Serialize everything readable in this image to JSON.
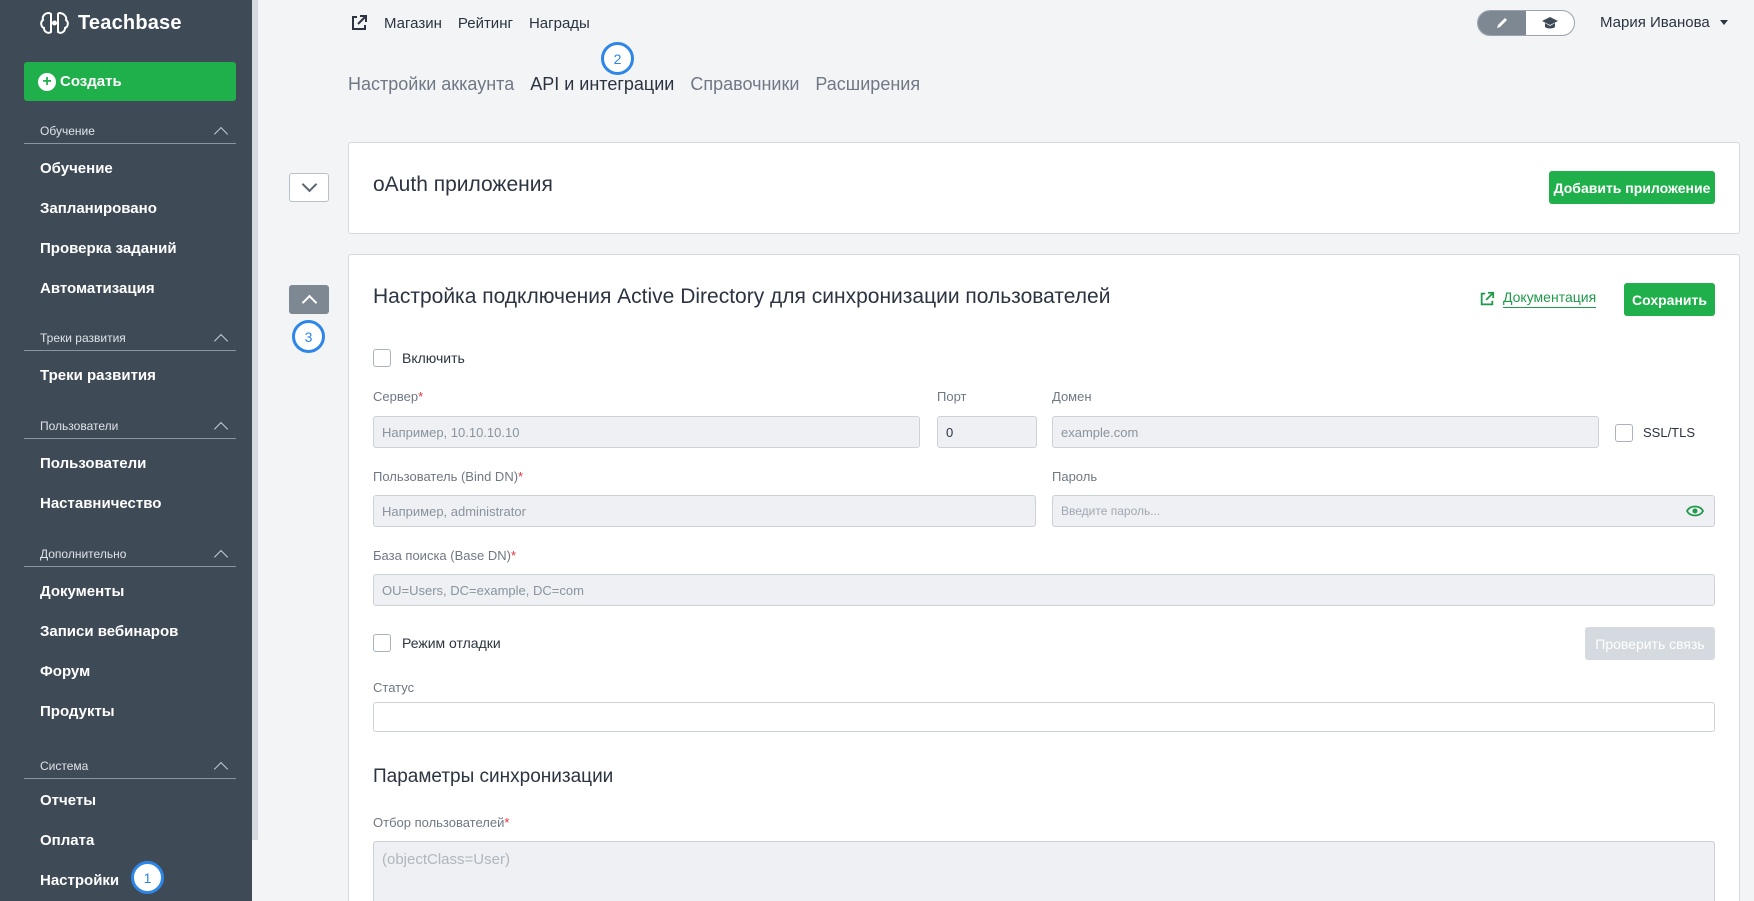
{
  "sidebar": {
    "logo": "Teachbase",
    "create_label": "Создать",
    "sections": [
      {
        "title": "Обучение",
        "items": [
          "Обучение",
          "Запланировано",
          "Проверка заданий",
          "Автоматизация"
        ]
      },
      {
        "title": "Треки развития",
        "items": [
          "Треки развития"
        ]
      },
      {
        "title": "Пользователи",
        "items": [
          "Пользователи",
          "Наставничество"
        ]
      },
      {
        "title": "Дополнительно",
        "items": [
          "Документы",
          "Записи вебинаров",
          "Форум",
          "Продукты"
        ]
      },
      {
        "title": "Система",
        "items": [
          "Отчеты",
          "Оплата",
          "Настройки"
        ]
      }
    ]
  },
  "badges": {
    "b1": "1",
    "b2": "2",
    "b3": "3"
  },
  "topnav": {
    "links": [
      "Магазин",
      "Рейтинг",
      "Награды"
    ]
  },
  "user": {
    "name": "Мария Иванова"
  },
  "subtabs": [
    "Настройки аккаунта",
    "API и интеграции",
    "Справочники",
    "Расширения"
  ],
  "oauth": {
    "title": "oAuth приложения",
    "add_label": "Добавить приложение"
  },
  "ad": {
    "title": "Настройка подключения Active Directory для синхронизации пользователей",
    "doc_label": "Документация",
    "save_label": "Сохранить",
    "enable_label": "Включить",
    "server_label": "Сервер",
    "server_placeholder": "Например, 10.10.10.10",
    "port_label": "Порт",
    "port_value": "0",
    "domain_label": "Домен",
    "domain_placeholder": "example.com",
    "ssl_label": "SSL/TLS",
    "user_label": "Пользователь (Bind DN)",
    "user_placeholder": "Например, administrator",
    "password_label": "Пароль",
    "password_placeholder": "Введите пароль...",
    "base_label": "База поиска (Base DN)",
    "base_placeholder": "OU=Users, DC=example, DC=com",
    "debug_label": "Режим отладки",
    "check_label": "Проверить связь",
    "status_label": "Статус",
    "sync_title": "Параметры синхронизации",
    "filter_label": "Отбор пользователей",
    "filter_placeholder": "(objectClass=User)",
    "required_mark": "*"
  },
  "colors": {
    "accent": "#20b04b",
    "sidebar": "#3f4a57",
    "badge": "#2e86e8"
  }
}
